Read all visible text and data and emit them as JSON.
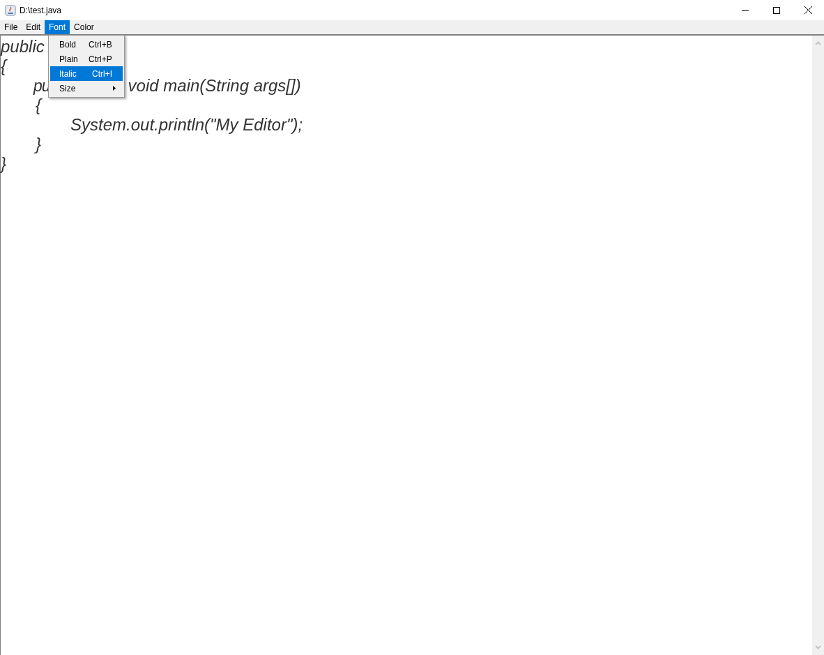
{
  "window": {
    "title": "D:\\test.java"
  },
  "menu_bar": [
    {
      "label": "File",
      "selected": false
    },
    {
      "label": "Edit",
      "selected": false
    },
    {
      "label": "Font",
      "selected": true
    },
    {
      "label": "Color",
      "selected": false
    }
  ],
  "font_menu": [
    {
      "label": "Bold",
      "shortcut": "Ctrl+B",
      "selected": false,
      "kind": "item"
    },
    {
      "label": "Plain",
      "shortcut": "Ctrl+P",
      "selected": false,
      "kind": "item"
    },
    {
      "label": "Italic",
      "shortcut": "Ctrl+I",
      "selected": true,
      "kind": "item"
    },
    {
      "label": "Size",
      "selected": false,
      "kind": "submenu"
    }
  ],
  "editor": {
    "lines": [
      {
        "segments": [
          "public"
        ]
      },
      {
        "segments": [
          "{"
        ]
      },
      {
        "children": [
          {
            "segments": [
              "pu",
              "void main(String args[])"
            ]
          },
          {
            "segments": [
              "{"
            ]
          },
          {
            "children": [
              {
                "segments": [
                  "System.out.println(\"My Editor\");"
                ]
              }
            ]
          },
          {
            "segments": [
              "}"
            ]
          }
        ]
      },
      {
        "segments": [
          "}"
        ]
      }
    ]
  }
}
